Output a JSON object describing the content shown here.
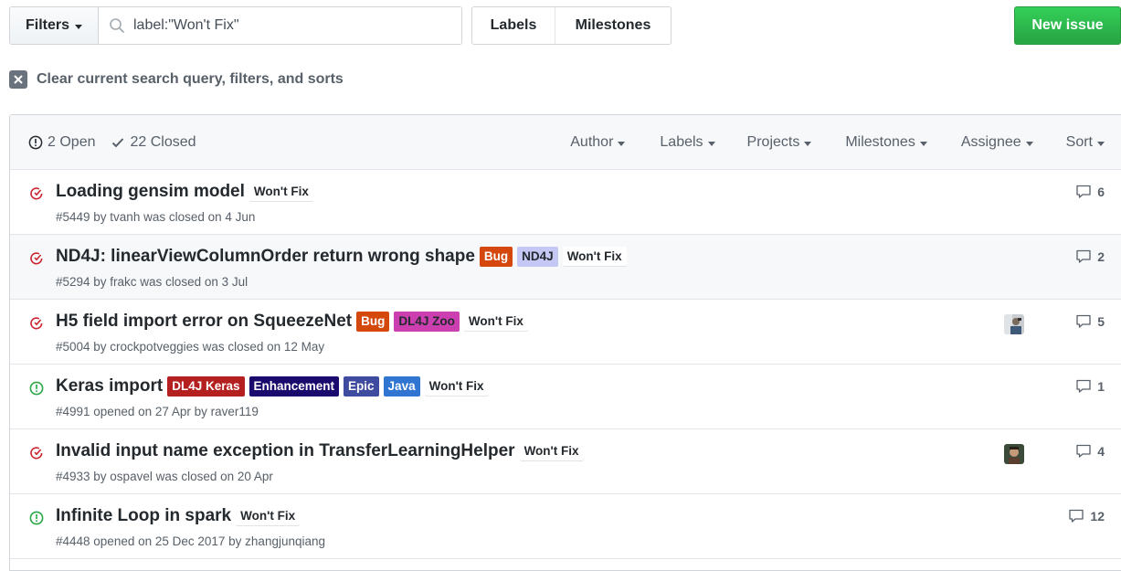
{
  "toolbar": {
    "filters_label": "Filters",
    "search_value": "label:\"Won't Fix\"",
    "labels_label": "Labels",
    "milestones_label": "Milestones",
    "new_issue_label": "New issue"
  },
  "clear_query": "Clear current search query, filters, and sorts",
  "header": {
    "open_label": "2 Open",
    "closed_label": "22 Closed",
    "filters": [
      "Author",
      "Labels",
      "Projects",
      "Milestones",
      "Assignee",
      "Sort"
    ]
  },
  "colors": {
    "accent_green": "#28a745",
    "closed_red": "#cb2431",
    "open_green": "#28a745"
  },
  "issues": [
    {
      "state": "closed",
      "title": "Loading gensim model",
      "labels": [
        {
          "name": "Won't Fix",
          "bg": "#ffffff",
          "fg": "#24292e"
        }
      ],
      "meta": "#5449 by tvanh was closed on 4 Jun",
      "comments": "6",
      "avatar": null
    },
    {
      "state": "closed",
      "title": "ND4J: linearViewColumnOrder return wrong shape",
      "labels": [
        {
          "name": "Bug",
          "bg": "#d4470d",
          "fg": "#ffffff"
        },
        {
          "name": "ND4J",
          "bg": "#c5c8f5",
          "fg": "#24292e"
        },
        {
          "name": "Won't Fix",
          "bg": "#ffffff",
          "fg": "#24292e"
        }
      ],
      "meta": "#5294 by frakc was closed on 3 Jul",
      "comments": "2",
      "avatar": null
    },
    {
      "state": "closed",
      "title": "H5 field import error on SqueezeNet",
      "labels": [
        {
          "name": "Bug",
          "bg": "#d4470d",
          "fg": "#ffffff"
        },
        {
          "name": "DL4J Zoo",
          "bg": "#cc3fb1",
          "fg": "#24292e"
        },
        {
          "name": "Won't Fix",
          "bg": "#ffffff",
          "fg": "#24292e"
        }
      ],
      "meta": "#5004 by crockpotveggies was closed on 12 May",
      "comments": "5",
      "avatar": "avatar-1"
    },
    {
      "state": "open",
      "title": "Keras import",
      "labels": [
        {
          "name": "DL4J Keras",
          "bg": "#b41f1f",
          "fg": "#ffffff"
        },
        {
          "name": "Enhancement",
          "bg": "#1a0a6e",
          "fg": "#ffffff"
        },
        {
          "name": "Epic",
          "bg": "#3e4b9e",
          "fg": "#ffffff"
        },
        {
          "name": "Java",
          "bg": "#2f75d1",
          "fg": "#ffffff"
        },
        {
          "name": "Won't Fix",
          "bg": "#ffffff",
          "fg": "#24292e"
        }
      ],
      "meta": "#4991 opened on 27 Apr by raver119",
      "comments": "1",
      "avatar": null
    },
    {
      "state": "closed",
      "title": "Invalid input name exception in TransferLearningHelper",
      "labels": [
        {
          "name": "Won't Fix",
          "bg": "#ffffff",
          "fg": "#24292e"
        }
      ],
      "meta": "#4933 by ospavel was closed on 20 Apr",
      "comments": "4",
      "avatar": "avatar-2"
    },
    {
      "state": "open",
      "title": "Infinite Loop in spark",
      "labels": [
        {
          "name": "Won't Fix",
          "bg": "#ffffff",
          "fg": "#24292e"
        }
      ],
      "meta": "#4448 opened on 25 Dec 2017 by zhangjunqiang",
      "comments": "12",
      "avatar": null
    }
  ]
}
